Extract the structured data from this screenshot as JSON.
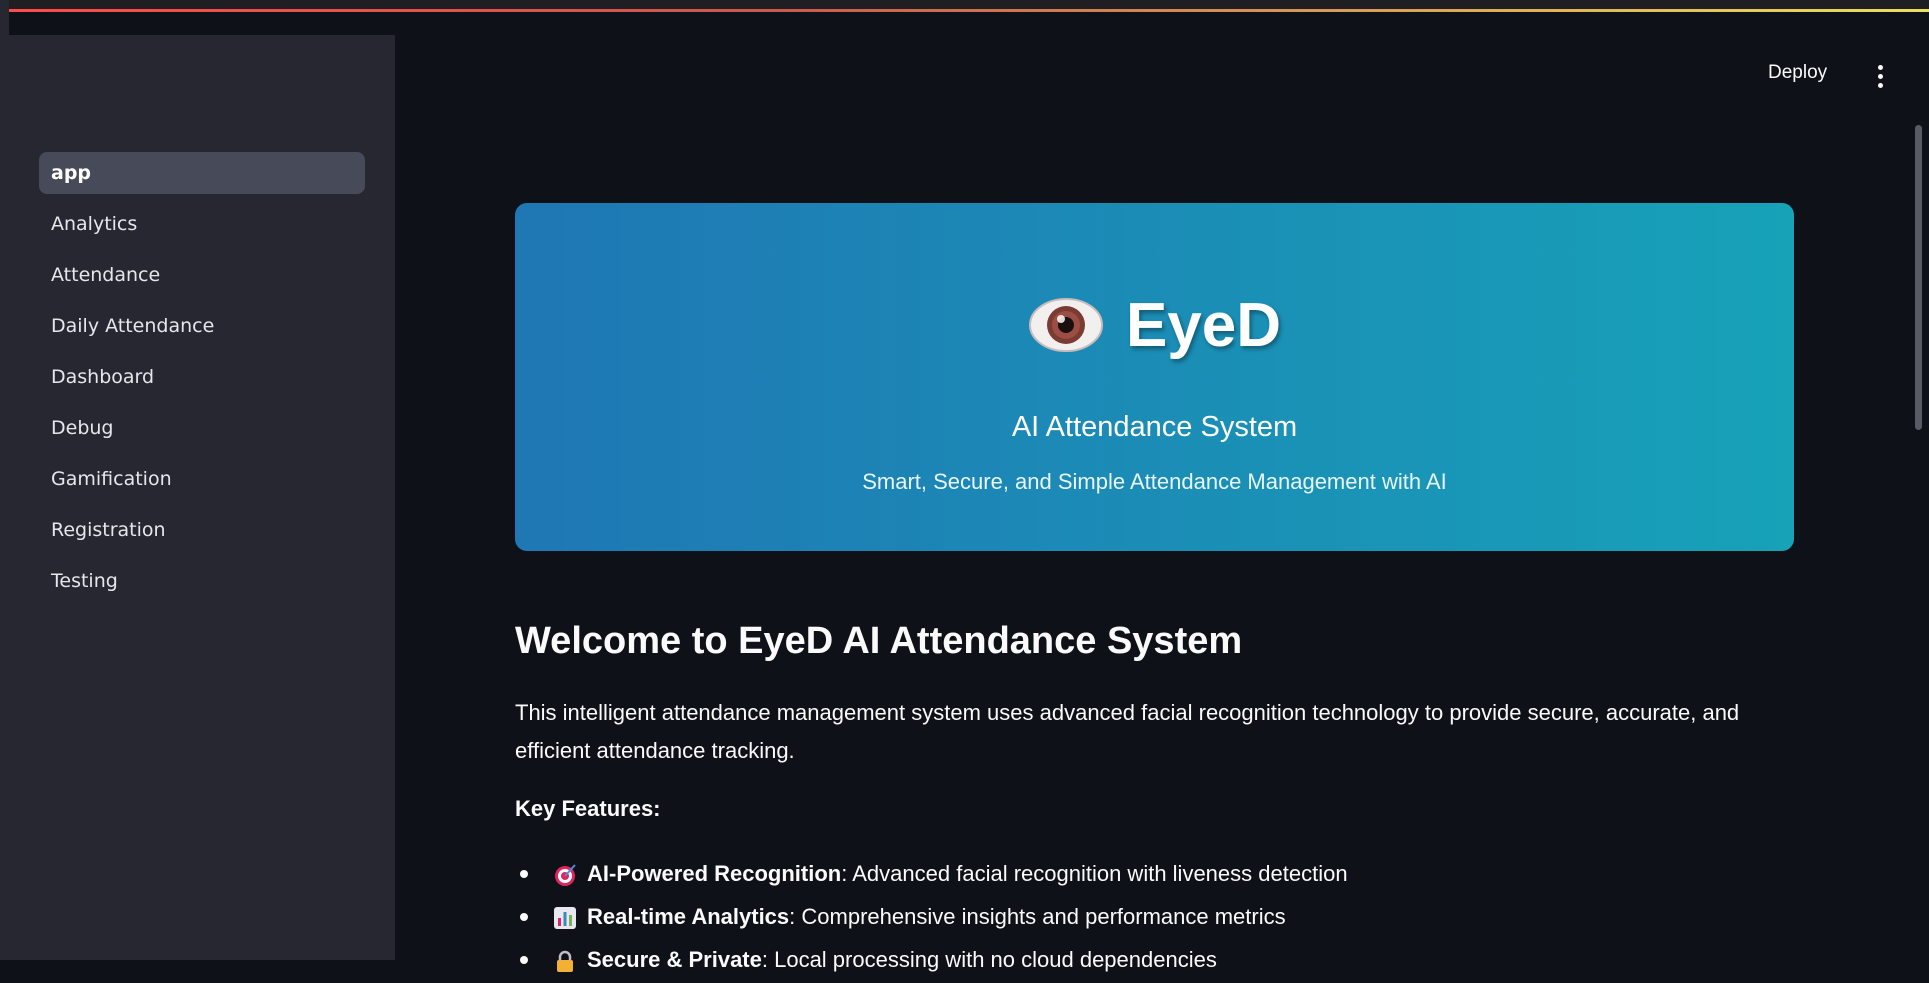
{
  "sidebar": {
    "items": [
      {
        "label": "app",
        "active": true
      },
      {
        "label": "Analytics"
      },
      {
        "label": "Attendance"
      },
      {
        "label": "Daily Attendance"
      },
      {
        "label": "Dashboard"
      },
      {
        "label": "Debug"
      },
      {
        "label": "Gamification"
      },
      {
        "label": "Registration"
      },
      {
        "label": "Testing"
      }
    ]
  },
  "header": {
    "deploy_label": "Deploy",
    "menu_icon": "more-vertical-icon"
  },
  "hero": {
    "icon": "eye-icon",
    "title": "EyeD",
    "subtitle": "AI Attendance System",
    "tagline": "Smart, Secure, and Simple Attendance Management with AI",
    "gradient": [
      "#1f77b4",
      "#17a2b8"
    ]
  },
  "main": {
    "welcome_title": "Welcome to EyeD AI Attendance System",
    "intro": "This intelligent attendance management system uses advanced facial recognition technology to provide secure, accurate, and efficient attendance tracking.",
    "key_features_label": "Key Features:",
    "features": [
      {
        "icon": "target-icon",
        "title": "AI-Powered Recognition",
        "description": ": Advanced facial recognition with liveness detection"
      },
      {
        "icon": "bar-chart-icon",
        "title": "Real-time Analytics",
        "description": ": Comprehensive insights and performance metrics"
      },
      {
        "icon": "lock-icon",
        "title": "Secure & Private",
        "description": ": Local processing with no cloud dependencies"
      }
    ]
  },
  "colors": {
    "background": "#0e1117",
    "sidebar": "#262730",
    "active_item": "#474a58"
  }
}
